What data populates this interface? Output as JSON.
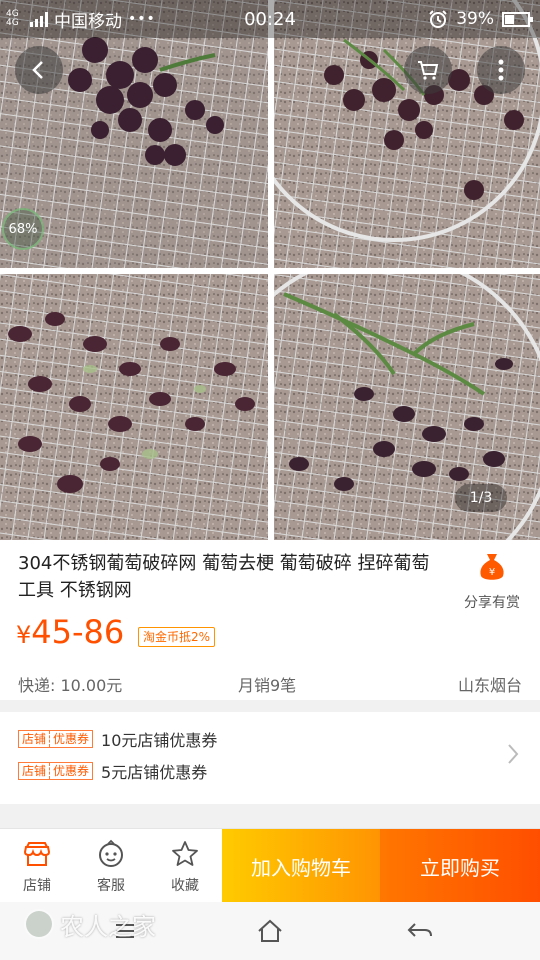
{
  "status_bar": {
    "network_label": "4G 4G",
    "carrier": "中国移动",
    "dots": "•••",
    "time": "00:24",
    "battery": "39%",
    "battery_level": 0.39,
    "alarm_icon": "alarm-clock-icon"
  },
  "gallery": {
    "image_count": 4,
    "zoom_badge": "68%",
    "page_indicator": "1/3",
    "buttons": [
      "back-icon",
      "cart-icon",
      "more-vertical-icon"
    ]
  },
  "product": {
    "title": "304不锈钢葡萄破碎网 葡萄去梗 葡萄破碎 捏碎葡萄工具 不锈钢网",
    "currency": "¥",
    "price": "45-86",
    "taojin_tag": "淘金币抵2%",
    "share_label": "分享有赏",
    "shipping": "快递: 10.00元",
    "monthly_sales": "月销9笔",
    "location": "山东烟台"
  },
  "coupons": {
    "tag_left": "店铺",
    "tag_right": "优惠券",
    "items": [
      "10元店铺优惠券",
      "5元店铺优惠券"
    ]
  },
  "action_bar": {
    "store": "店铺",
    "service": "客服",
    "favorite": "收藏",
    "add_to_cart": "加入购物车",
    "buy_now": "立即购买",
    "accent": "#ff5000",
    "cart_gradient": [
      "#ffcb00",
      "#ff9402"
    ],
    "buy_gradient": [
      "#ff7700",
      "#ff4e00"
    ]
  },
  "watermark": {
    "text": "农人之家"
  }
}
